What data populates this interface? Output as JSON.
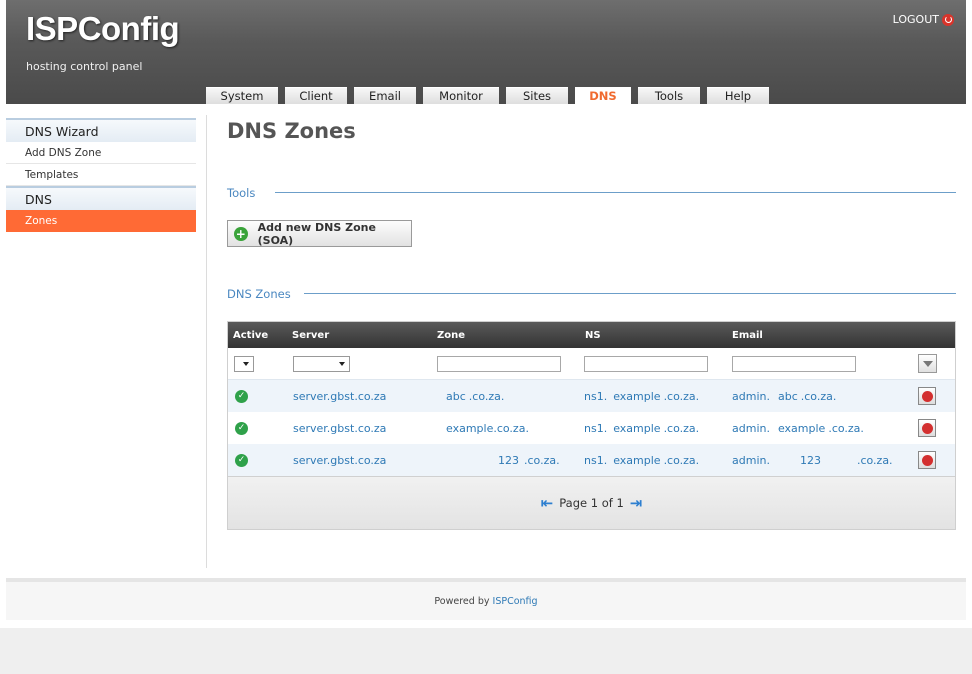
{
  "header": {
    "logo": "ISPConfig",
    "tagline": "hosting control panel",
    "logout_label": "LOGOUT"
  },
  "tabs": [
    {
      "label": "System",
      "active": false
    },
    {
      "label": "Client",
      "active": false
    },
    {
      "label": "Email",
      "active": false
    },
    {
      "label": "Monitor",
      "active": false
    },
    {
      "label": "Sites",
      "active": false
    },
    {
      "label": "DNS",
      "active": true
    },
    {
      "label": "Tools",
      "active": false
    },
    {
      "label": "Help",
      "active": false
    }
  ],
  "sidebar": {
    "sections": [
      {
        "title": "DNS Wizard",
        "items": [
          {
            "label": "Add DNS Zone"
          },
          {
            "label": "Templates"
          }
        ]
      },
      {
        "title": "DNS",
        "items": [
          {
            "label": "Zones",
            "active": true
          }
        ]
      }
    ]
  },
  "main": {
    "title": "DNS Zones",
    "tools_label": "Tools",
    "add_button_label": "Add new DNS Zone (SOA)",
    "list_label": "DNS Zones"
  },
  "table": {
    "columns": [
      "Active",
      "Server",
      "Zone",
      "NS",
      "Email"
    ],
    "rows": [
      {
        "server": "server.gbst.co.za",
        "zone_link": "abc",
        "zone_suffix": ".co.za.",
        "ns_prefix": "ns1.",
        "ns_link": "example",
        "ns_suffix": ".co.za.",
        "email_prefix": "admin.",
        "email_link": "abc",
        "email_suffix": ".co.za."
      },
      {
        "server": "server.gbst.co.za",
        "zone_link": "example.co.za.",
        "zone_suffix": "",
        "ns_prefix": "ns1.",
        "ns_link": "example",
        "ns_suffix": ".co.za.",
        "email_prefix": "admin.",
        "email_link": "example",
        "email_suffix": ".co.za."
      },
      {
        "server": "server.gbst.co.za",
        "zone_link": "123",
        "zone_suffix": ".co.za.",
        "ns_prefix": "ns1.",
        "ns_link": "example",
        "ns_suffix": ".co.za.",
        "email_prefix": "admin.",
        "email_link": "123",
        "email_suffix": ".co.za."
      }
    ],
    "pagination": "Page 1 of 1"
  },
  "footer": {
    "powered_prefix": "Powered by",
    "powered_link": "ISPConfig"
  },
  "colors": {
    "accent": "#ff6a35",
    "link": "#2e79b5",
    "section": "#4a87c0"
  }
}
